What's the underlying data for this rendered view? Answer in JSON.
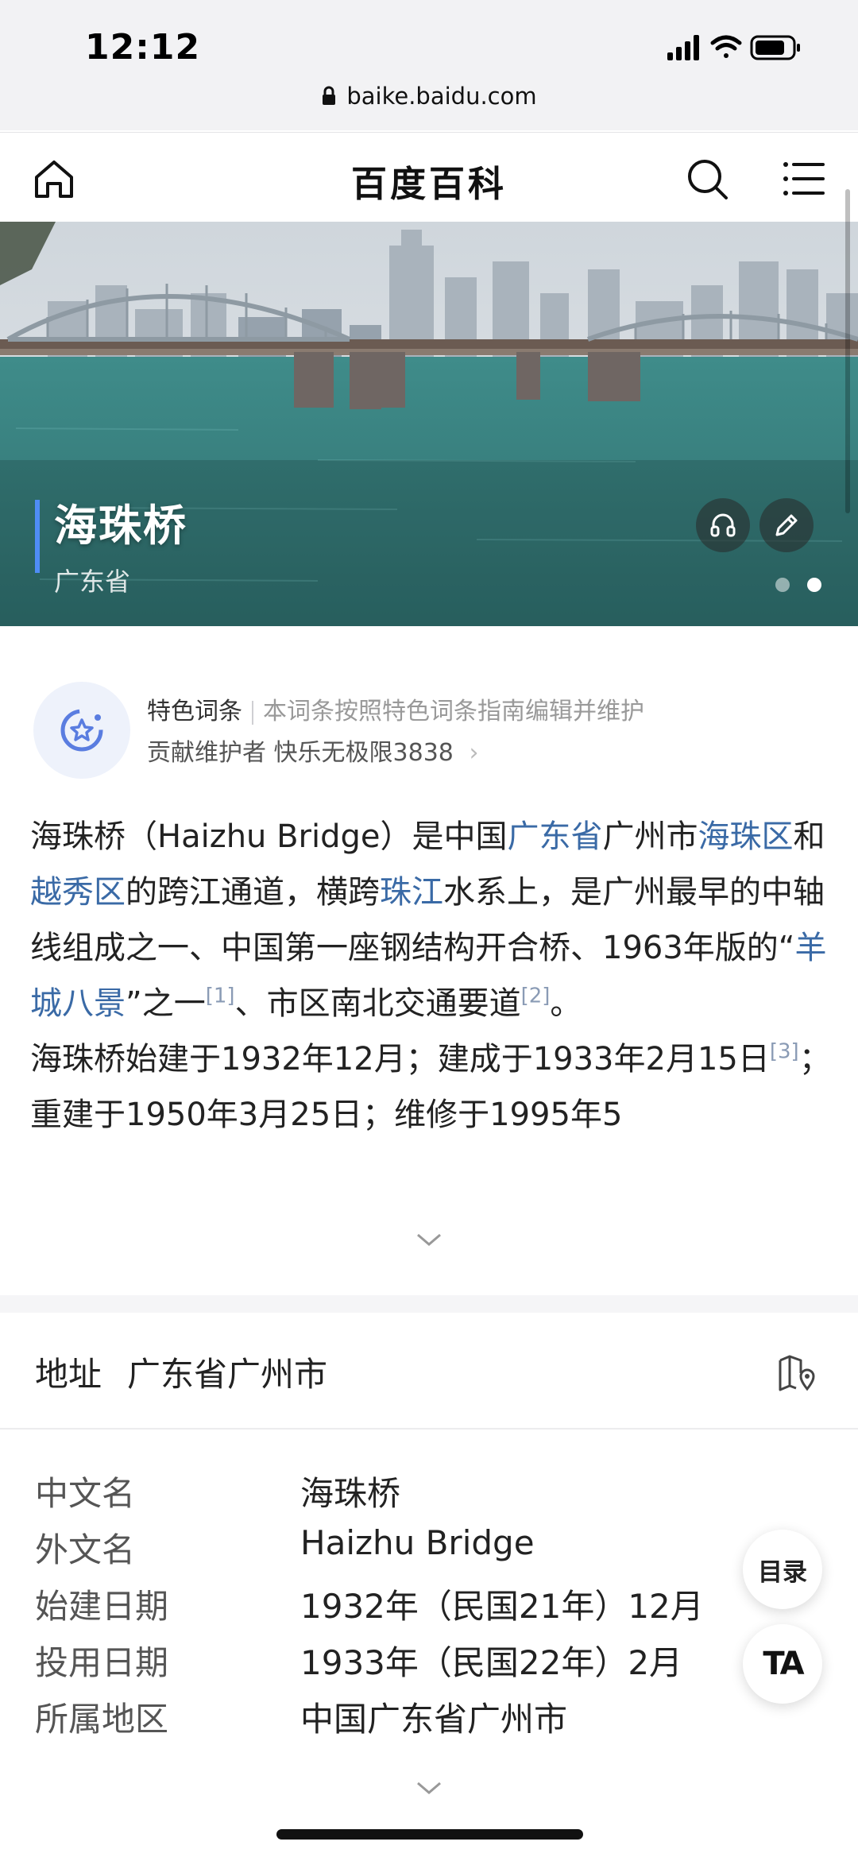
{
  "status_bar": {
    "time": "12:12"
  },
  "browser": {
    "url": "baike.baidu.com"
  },
  "header": {
    "title": "百度百科"
  },
  "hero": {
    "title": "海珠桥",
    "subtitle": "广东省"
  },
  "feature": {
    "label": "特色词条",
    "description": "本词条按照特色词条指南编辑并维护",
    "contributor_prefix": "贡献维护者",
    "contributor_name": "快乐无极限3838"
  },
  "summary": {
    "p1_a": "海珠桥（Haizhu Bridge）是中国",
    "p1_link1": "广东省",
    "p1_b": "广州市",
    "p1_link2": "海珠区",
    "p1_c": "和",
    "p1_link3": "越秀区",
    "p1_d": "的跨江通道，横跨",
    "p1_link4": "珠江",
    "p1_e": "水系上，是广州最早的中轴线组成之一、中国第一座钢结构开合桥、1963年版的“",
    "p1_link5": "羊城八景",
    "p1_f": "”之一",
    "ref1": "[1]",
    "p1_g": "、市区南北交通要道",
    "ref2": "[2]",
    "p1_h": "。",
    "p2_a": "海珠桥始建于1932年12月；建成于1933年2月15日",
    "ref3": "[3]",
    "p2_b": "；重建于1950年3月25日；维修于1995年5"
  },
  "address": {
    "label": "地址",
    "value": "广东省广州市"
  },
  "info": [
    {
      "key": "中文名",
      "value": "海珠桥"
    },
    {
      "key": "外文名",
      "value": "Haizhu Bridge"
    },
    {
      "key": "始建日期",
      "value": "1932年（民国21年）12月"
    },
    {
      "key": "投用日期",
      "value": "1933年（民国22年）2月"
    },
    {
      "key": "所属地区",
      "value": "中国广东省广州市"
    }
  ],
  "fab": {
    "toc_label": "目录",
    "font_label": "TA"
  },
  "colors": {
    "link": "#3a6aa6",
    "accent": "#4f8df5"
  }
}
